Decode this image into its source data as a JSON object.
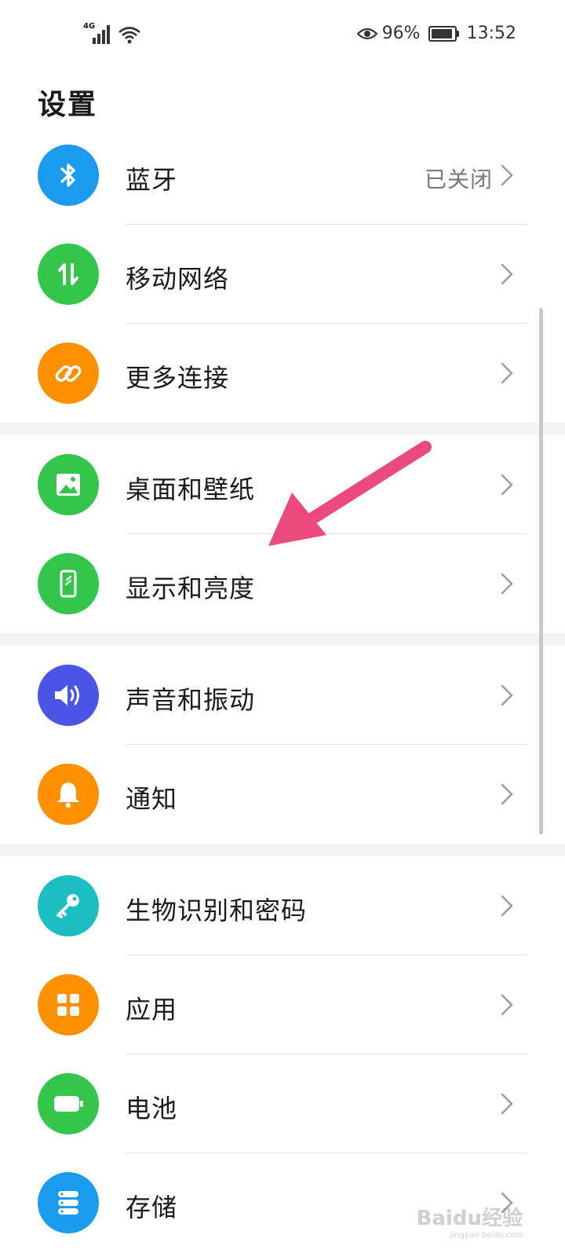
{
  "status_bar": {
    "network": "4G",
    "battery_percent": "96%",
    "battery_level": 0.96,
    "time": "13:52"
  },
  "page": {
    "title": "设置"
  },
  "groups": [
    {
      "items": [
        {
          "label": "蓝牙",
          "value": "已关闭",
          "icon": "bluetooth-icon",
          "color": "#1a9bf0"
        },
        {
          "label": "移动网络",
          "icon": "mobile-data-icon",
          "color": "#33c64a"
        },
        {
          "label": "更多连接",
          "icon": "link-icon",
          "color": "#ff9000"
        }
      ]
    },
    {
      "items": [
        {
          "label": "桌面和壁纸",
          "icon": "wallpaper-icon",
          "color": "#33c64a"
        },
        {
          "label": "显示和亮度",
          "icon": "display-icon",
          "color": "#33c64a"
        }
      ]
    },
    {
      "items": [
        {
          "label": "声音和振动",
          "icon": "sound-icon",
          "color": "#4a55e6"
        },
        {
          "label": "通知",
          "icon": "bell-icon",
          "color": "#ff9000"
        }
      ]
    },
    {
      "items": [
        {
          "label": "生物识别和密码",
          "icon": "key-icon",
          "color": "#1bbfc2"
        },
        {
          "label": "应用",
          "icon": "apps-icon",
          "color": "#ff9000"
        },
        {
          "label": "电池",
          "icon": "battery-icon",
          "color": "#33c64a"
        },
        {
          "label": "存储",
          "icon": "storage-icon",
          "color": "#1a9bf0"
        }
      ]
    }
  ],
  "annotation": {
    "arrow_color": "#ec4a7f"
  },
  "watermark": {
    "text": "Baidu经验",
    "sub": "jingyan.baidu.com"
  }
}
